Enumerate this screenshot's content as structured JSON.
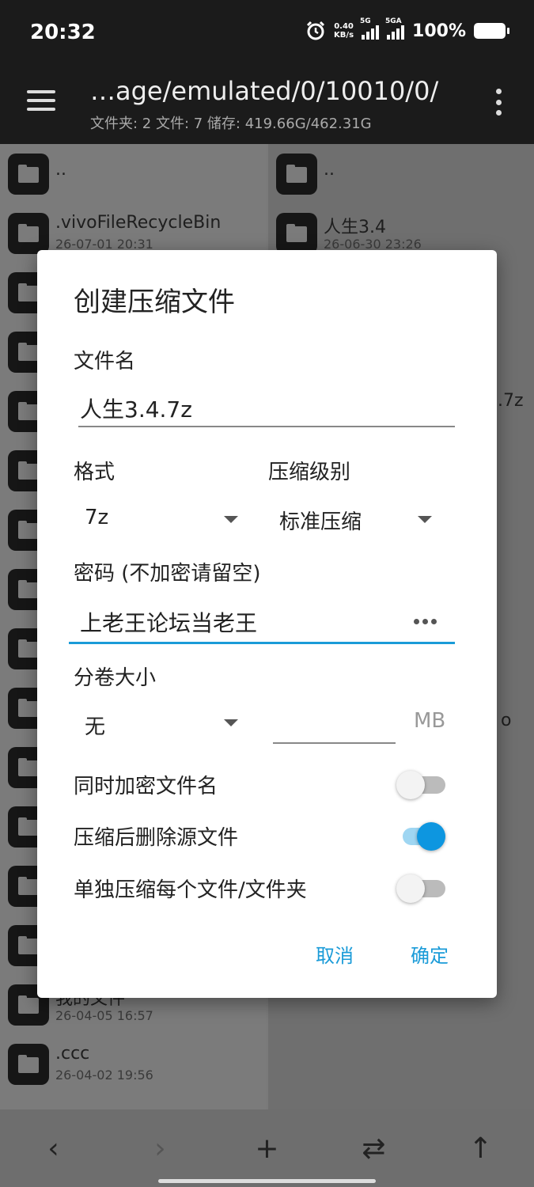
{
  "status_bar": {
    "time": "20:32",
    "net_speed_value": "0.40",
    "net_speed_unit": "KB/s",
    "sim1": "5G",
    "sim2": "5GA",
    "battery": "100%"
  },
  "app_bar": {
    "path": "…age/emulated/0/10010/0/",
    "info": "文件夹: 2  文件: 7  储存: 419.66G/462.31G"
  },
  "left_pane": {
    "items": [
      {
        "name": "..",
        "date": ""
      },
      {
        "name": ".vivoFileRecycleBin",
        "date": "26-07-01 20:31"
      },
      {
        "name": "",
        "date": ""
      },
      {
        "name": "",
        "date": ""
      },
      {
        "name": "",
        "date": ""
      },
      {
        "name": "",
        "date": ""
      },
      {
        "name": "",
        "date": ""
      },
      {
        "name": "",
        "date": ""
      },
      {
        "name": "",
        "date": ""
      },
      {
        "name": "",
        "date": ""
      },
      {
        "name": "",
        "date": ""
      },
      {
        "name": "",
        "date": ""
      },
      {
        "name": "",
        "date": ""
      },
      {
        "name": "",
        "date": ""
      },
      {
        "name": "我的文件",
        "date": "26-04-05 16:57"
      },
      {
        "name": ".ccc",
        "date": "26-04-02 19:56"
      }
    ]
  },
  "right_pane": {
    "items": [
      {
        "name": "..",
        "date": ""
      },
      {
        "name": "人生3.4",
        "date": "26-06-30 23:26"
      }
    ],
    "peek_1": ".7z",
    "peek_2": "o"
  },
  "dialog": {
    "title": "创建压缩文件",
    "filename_label": "文件名",
    "filename_value": "人生3.4.7z",
    "format_label": "格式",
    "format_value": "7z",
    "level_label": "压缩级别",
    "level_value": "标准压缩",
    "password_label": "密码 (不加密请留空)",
    "password_value": "上老王论坛当老王",
    "split_label": "分卷大小",
    "split_value": "无",
    "split_unit": "MB",
    "encrypt_names_label": "同时加密文件名",
    "encrypt_names_on": false,
    "delete_source_label": "压缩后删除源文件",
    "delete_source_on": true,
    "separate_label": "单独压缩每个文件/文件夹",
    "separate_on": false,
    "cancel": "取消",
    "ok": "确定"
  },
  "bottom_bar": {
    "back_icon": "‹",
    "forward_icon": "›",
    "add_icon": "+",
    "swap_icon": "⇄",
    "up_icon": "↑"
  }
}
